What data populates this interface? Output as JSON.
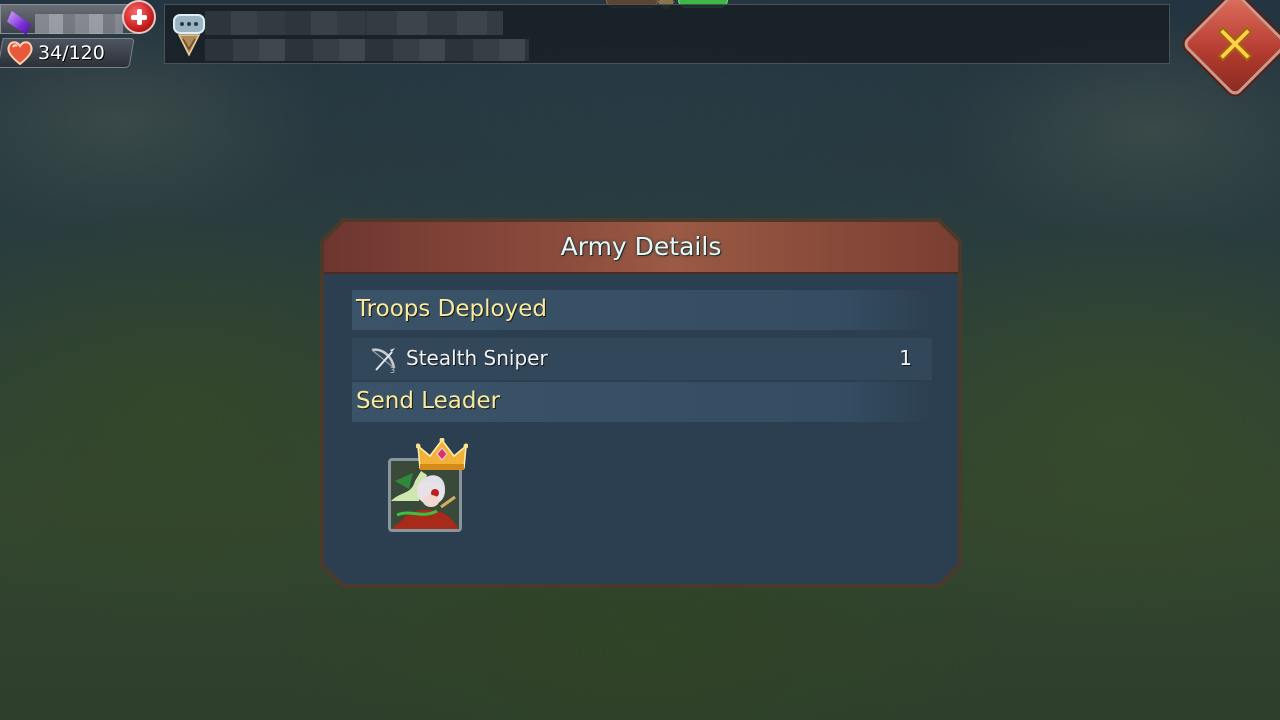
{
  "resources": {
    "gem_icon": "purple-gem-icon",
    "add_icon": "plus-icon",
    "stamina_icon": "heart-icon",
    "stamina_value": "34/120"
  },
  "chat": {
    "icon": "chat-badge-icon"
  },
  "close_icon": "close-x-icon",
  "modal": {
    "title": "Army Details",
    "troops_section": {
      "label": "Troops Deployed",
      "rows": [
        {
          "icon": "crossbow-icon",
          "name": "Stealth Sniper",
          "count": "1"
        }
      ]
    },
    "leader_section": {
      "label": "Send Leader",
      "leader_icon": "leader-portrait-icon",
      "crown_icon": "crown-icon"
    }
  },
  "colors": {
    "title_text": "#eaf6f4",
    "section_text": "#f8eaa0",
    "header_red": "#8a4a3c",
    "panel_blue": "#2c3f50",
    "close_red": "#b23a2e"
  }
}
